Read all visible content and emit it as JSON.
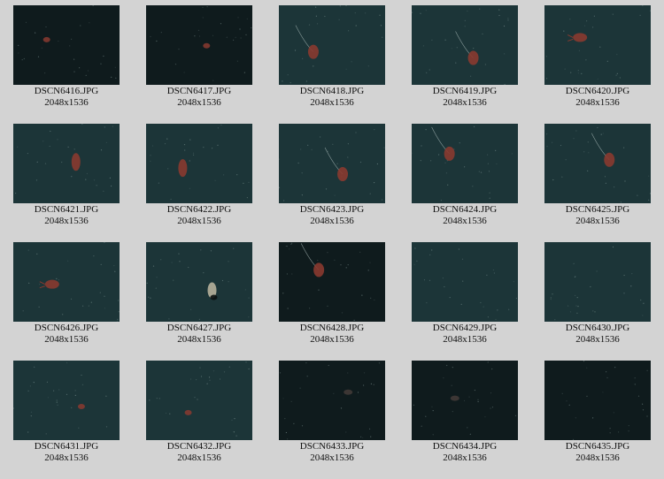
{
  "thumbnails": [
    {
      "filename": "DSCN6416.JPG",
      "dimensions": "2048x1536",
      "tone": "dark",
      "subject": "small-red-creature"
    },
    {
      "filename": "DSCN6417.JPG",
      "dimensions": "2048x1536",
      "tone": "dark",
      "subject": "small-red-creature"
    },
    {
      "filename": "DSCN6418.JPG",
      "dimensions": "2048x1536",
      "tone": "teal",
      "subject": "red-creature-with-tentacle"
    },
    {
      "filename": "DSCN6419.JPG",
      "dimensions": "2048x1536",
      "tone": "teal",
      "subject": "red-creature-with-tentacle"
    },
    {
      "filename": "DSCN6420.JPG",
      "dimensions": "2048x1536",
      "tone": "teal",
      "subject": "red-creature"
    },
    {
      "filename": "DSCN6421.JPG",
      "dimensions": "2048x1536",
      "tone": "teal",
      "subject": "red-jellyfish"
    },
    {
      "filename": "DSCN6422.JPG",
      "dimensions": "2048x1536",
      "tone": "teal",
      "subject": "red-jellyfish"
    },
    {
      "filename": "DSCN6423.JPG",
      "dimensions": "2048x1536",
      "tone": "teal",
      "subject": "red-creature-with-tentacle"
    },
    {
      "filename": "DSCN6424.JPG",
      "dimensions": "2048x1536",
      "tone": "teal",
      "subject": "red-creature-with-tentacle"
    },
    {
      "filename": "DSCN6425.JPG",
      "dimensions": "2048x1536",
      "tone": "teal",
      "subject": "red-creature-with-tentacle"
    },
    {
      "filename": "DSCN6426.JPG",
      "dimensions": "2048x1536",
      "tone": "teal",
      "subject": "red-creature"
    },
    {
      "filename": "DSCN6427.JPG",
      "dimensions": "2048x1536",
      "tone": "teal",
      "subject": "pale-creature"
    },
    {
      "filename": "DSCN6428.JPG",
      "dimensions": "2048x1536",
      "tone": "dark",
      "subject": "red-creature-with-tentacle"
    },
    {
      "filename": "DSCN6429.JPG",
      "dimensions": "2048x1536",
      "tone": "teal",
      "subject": "empty"
    },
    {
      "filename": "DSCN6430.JPG",
      "dimensions": "2048x1536",
      "tone": "teal",
      "subject": "empty"
    },
    {
      "filename": "DSCN6431.JPG",
      "dimensions": "2048x1536",
      "tone": "teal",
      "subject": "small-red-creature"
    },
    {
      "filename": "DSCN6432.JPG",
      "dimensions": "2048x1536",
      "tone": "teal",
      "subject": "small-red-creature"
    },
    {
      "filename": "DSCN6433.JPG",
      "dimensions": "2048x1536",
      "tone": "dark",
      "subject": "faint-creature"
    },
    {
      "filename": "DSCN6434.JPG",
      "dimensions": "2048x1536",
      "tone": "dark",
      "subject": "faint-creature"
    },
    {
      "filename": "DSCN6435.JPG",
      "dimensions": "2048x1536",
      "tone": "dark",
      "subject": "empty"
    }
  ],
  "colors": {
    "page_background": "#d3d3d3",
    "text": "#111111",
    "water_teal": "#1c3538",
    "water_dark": "#0f1b1d",
    "creature_red": "#8a3a30"
  }
}
